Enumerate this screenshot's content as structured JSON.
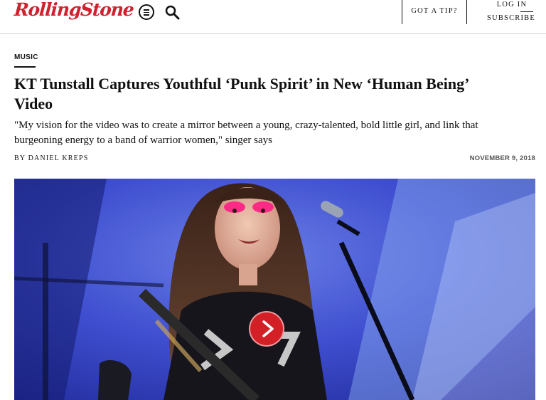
{
  "header": {
    "logo": "RollingStone",
    "tip_label": "GOT A TIP?",
    "login_label": "LOG IN",
    "subscribe_label": "SUBSCRIBE"
  },
  "article": {
    "category": "MUSIC",
    "headline": "KT Tunstall Captures Youthful ‘Punk Spirit’ in New ‘Human Being’ Video",
    "dek": "\"My vision for the video was to create a mirror between a young, crazy-talented, bold little girl, and link that burgeoning energy to a band of warrior women,\" singer says",
    "byline": "BY DANIEL KREPS",
    "date": "NOVEMBER 9, 2018"
  },
  "icons": {
    "menu": "menu-icon",
    "search": "search-icon",
    "play": "play-icon"
  },
  "colors": {
    "brand": "#d0212e",
    "play_button": "#d32027",
    "stage_light": "#3f4fd0"
  }
}
